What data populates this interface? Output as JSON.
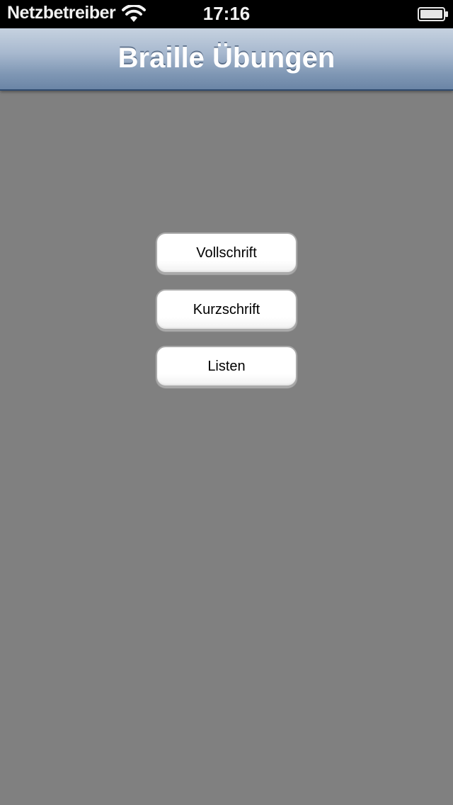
{
  "status_bar": {
    "carrier": "Netzbetreiber",
    "time": "17:16",
    "wifi_icon": "wifi-icon",
    "battery_icon": "battery-icon"
  },
  "nav_bar": {
    "title": "Braille Übungen"
  },
  "menu": {
    "items": [
      {
        "label": "Vollschrift"
      },
      {
        "label": "Kurzschrift"
      },
      {
        "label": "Listen"
      }
    ]
  },
  "colors": {
    "background": "#808080",
    "status_bar": "#000000",
    "nav_bar_top": "#c6d2e0",
    "nav_bar_bottom": "#6b85a6",
    "button": "#ffffff"
  }
}
